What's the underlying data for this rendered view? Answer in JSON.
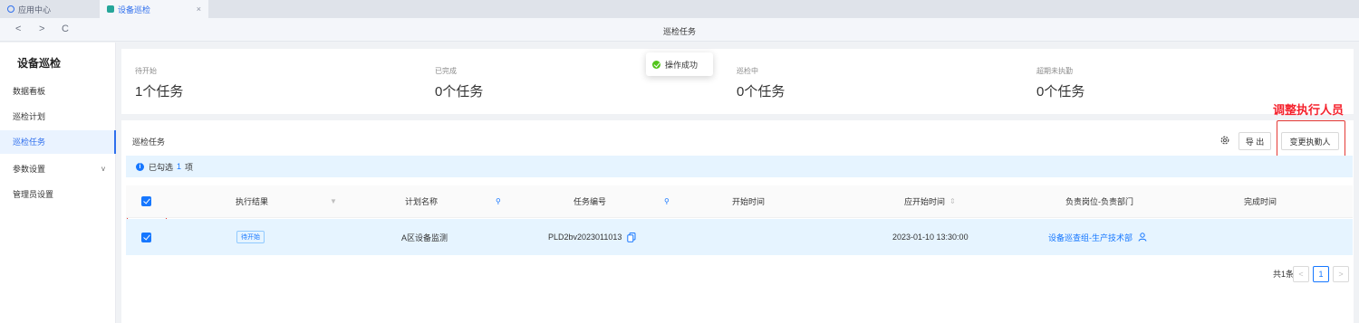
{
  "tabs": [
    {
      "label": "应用中心"
    },
    {
      "label": "设备巡检",
      "close": "×"
    }
  ],
  "nav": {
    "back": "<",
    "forward": ">",
    "refresh": "C",
    "title": "巡检任务"
  },
  "sidebar": {
    "title": "设备巡检",
    "items": [
      {
        "label": "数据看板"
      },
      {
        "label": "巡检计划"
      },
      {
        "label": "巡检任务"
      },
      {
        "label": "参数设置",
        "chevron": "v"
      },
      {
        "label": "管理员设置"
      }
    ]
  },
  "stats": [
    {
      "label": "待开始",
      "value": "1个任务"
    },
    {
      "label": "已完成",
      "value": "0个任务"
    },
    {
      "label": "巡检中",
      "value": "0个任务"
    },
    {
      "label": "超期未执勤",
      "value": "0个任务"
    }
  ],
  "toast": {
    "text": "操作成功"
  },
  "card": {
    "title": "巡检任务",
    "export_label": "导 出",
    "change_label": "变更执勤人",
    "annotation": "调整执行人员"
  },
  "selection": {
    "prefix": "已勾选",
    "count": "1",
    "suffix": "项"
  },
  "table": {
    "headers": [
      "执行结果",
      "计划名称",
      "任务编号",
      "开始时间",
      "应开始时间",
      "负责岗位-负责部门",
      "完成时间"
    ],
    "rows": [
      {
        "status": "待开始",
        "plan": "A区设备监测",
        "code": "PLD2bv2023011013",
        "start": "",
        "due": "2023-01-10 13:30:00",
        "dept": "设备巡查组-生产技术部",
        "finish": ""
      }
    ]
  },
  "pagination": {
    "total": "共1条",
    "page": "1",
    "prev": "<",
    "next": ">"
  },
  "colors": {
    "primary": "#1677ff",
    "annotation": "#e53935",
    "success": "#52c41a"
  }
}
